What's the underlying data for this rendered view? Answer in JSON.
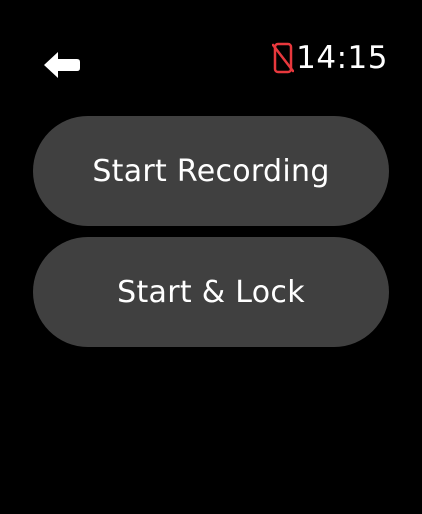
{
  "status_bar": {
    "time": "14:15",
    "back_icon": "back-arrow-icon",
    "phone_status_icon": "phone-disconnected-icon",
    "alert_color": "#e8383d"
  },
  "actions": {
    "start_recording_label": "Start Recording",
    "start_lock_label": "Start & Lock"
  },
  "colors": {
    "background": "#000000",
    "button_background": "#404040",
    "text": "#ffffff"
  }
}
